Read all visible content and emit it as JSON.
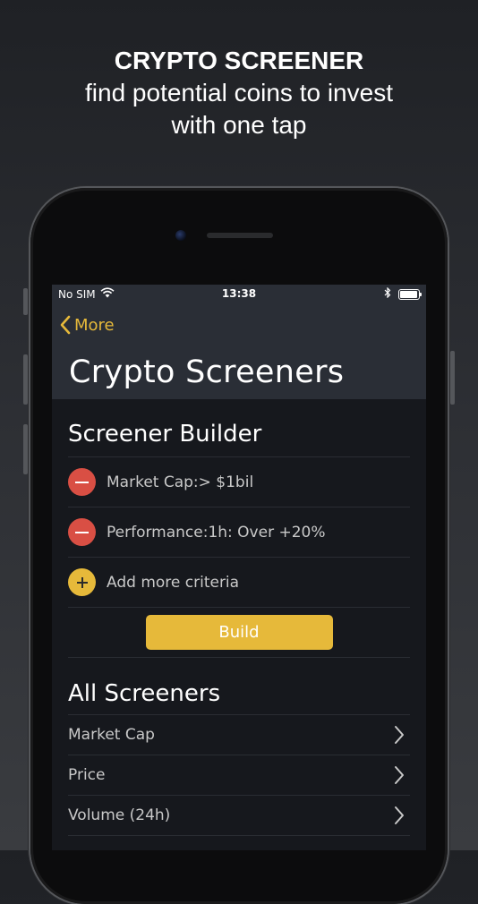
{
  "promo": {
    "headline": "CRYPTO SCREENER",
    "line1": "find potential coins to invest",
    "line2": "with one tap"
  },
  "status_bar": {
    "carrier": "No SIM",
    "time": "13:38",
    "icons": [
      "wifi-icon",
      "bluetooth-icon",
      "battery-icon"
    ]
  },
  "nav": {
    "back_label": "More",
    "title": "Crypto Screeners"
  },
  "builder": {
    "title": "Screener Builder",
    "criteria": [
      {
        "label": "Market Cap:> $1bil",
        "icon": "remove-icon"
      },
      {
        "label": "Performance:1h: Over +20%",
        "icon": "remove-icon"
      }
    ],
    "add_label": "Add more criteria",
    "build_label": "Build"
  },
  "all_screeners": {
    "title": "All Screeners",
    "items": [
      "Market Cap",
      "Price",
      "Volume (24h)"
    ]
  },
  "colors": {
    "accent": "#e6b93a",
    "remove": "#d94f44",
    "nav_bg": "#2a2e36",
    "screen_bg": "#16181d"
  }
}
